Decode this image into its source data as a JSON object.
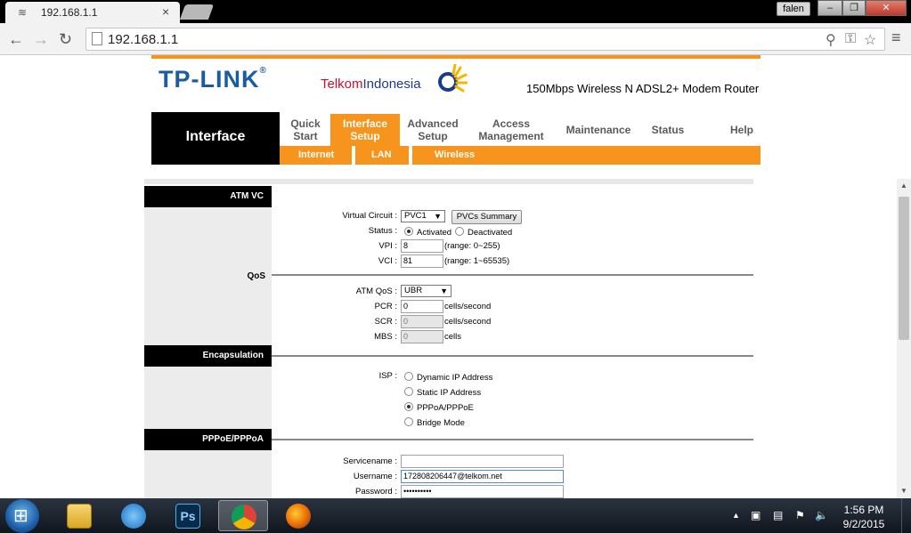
{
  "browser": {
    "tab_title": "192.168.1.1",
    "url": "192.168.1.1",
    "profile": "falen",
    "window_buttons": [
      "–",
      "❐",
      "✕"
    ]
  },
  "header": {
    "logo": "TP-LINK",
    "logo_reg": "®",
    "partner_prefix": "Telkom",
    "partner_suffix": "Indonesia",
    "model": "150Mbps Wireless N ADSL2+ Modem Router"
  },
  "nav": {
    "current": "Interface",
    "items": [
      {
        "line1": "Quick",
        "line2": "Start"
      },
      {
        "line1": "Interface",
        "line2": "Setup"
      },
      {
        "line1": "Advanced",
        "line2": "Setup"
      },
      {
        "line1": "Access",
        "line2": "Management"
      },
      {
        "line1": "Maintenance",
        "line2": ""
      },
      {
        "line1": "Status",
        "line2": ""
      },
      {
        "line1": "Help",
        "line2": ""
      }
    ],
    "subitems": [
      "Internet",
      "LAN",
      "Wireless"
    ]
  },
  "sections": {
    "atm_vc": "ATM VC",
    "qos": "QoS",
    "encapsulation": "Encapsulation",
    "pppoe": "PPPoE/PPPoA"
  },
  "atm": {
    "virtual_circuit_label": "Virtual Circuit :",
    "virtual_circuit_value": "PVC1",
    "pvc_summary_button": "PVCs Summary",
    "status_label": "Status :",
    "status_options": [
      "Activated",
      "Deactivated"
    ],
    "status_selected": "Activated",
    "vpi_label": "VPI :",
    "vpi_value": "8",
    "vpi_range": "(range: 0~255)",
    "vci_label": "VCI :",
    "vci_value": "81",
    "vci_range": "(range: 1~65535)"
  },
  "qos": {
    "atm_qos_label": "ATM QoS :",
    "atm_qos_value": "UBR",
    "pcr_label": "PCR :",
    "pcr_value": "0",
    "pcr_unit": "cells/second",
    "scr_label": "SCR :",
    "scr_value": "0",
    "scr_unit": "cells/second",
    "mbs_label": "MBS :",
    "mbs_value": "0",
    "mbs_unit": "cells"
  },
  "encapsulation": {
    "isp_label": "ISP :",
    "options": [
      "Dynamic IP Address",
      "Static IP Address",
      "PPPoA/PPPoE",
      "Bridge Mode"
    ],
    "selected": "PPPoA/PPPoE"
  },
  "pppoe": {
    "servicename_label": "Servicename :",
    "servicename_value": "",
    "username_label": "Username :",
    "username_value": "172808206447@telkom.net",
    "password_label": "Password :",
    "password_value": "••••••••••"
  },
  "taskbar": {
    "apps": [
      "explorer",
      "internet-explorer",
      "photoshop",
      "chrome",
      "firefox"
    ],
    "photoshop_label": "Ps",
    "time": "1:56 PM",
    "date": "9/2/2015"
  },
  "colors": {
    "accent": "#f7941d",
    "brand": "#1a5c9e"
  }
}
